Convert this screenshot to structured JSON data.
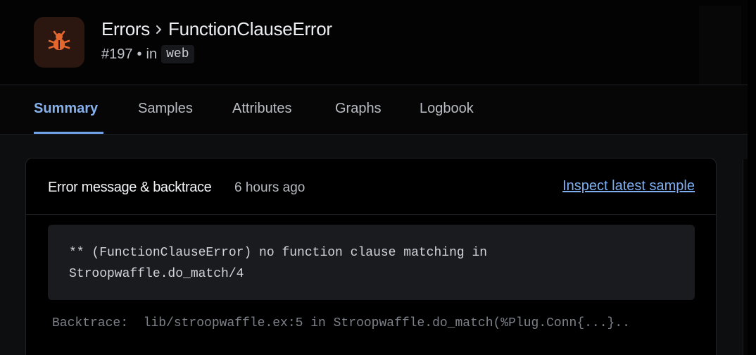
{
  "breadcrumb": {
    "parent": "Errors",
    "current": "FunctionClauseError"
  },
  "incident": {
    "number": "#197",
    "in_label": "in",
    "namespace": "web"
  },
  "tabs": [
    {
      "label": "Summary",
      "active": true
    },
    {
      "label": "Samples",
      "active": false
    },
    {
      "label": "Attributes",
      "active": false
    },
    {
      "label": "Graphs",
      "active": false
    },
    {
      "label": "Logbook",
      "active": false
    }
  ],
  "card": {
    "title": "Error message & backtrace",
    "time": "6 hours ago",
    "inspect_link": "Inspect latest sample",
    "message": "** (FunctionClauseError) no function clause matching in\nStroopwaffle.do_match/4",
    "backtrace": "Backtrace:  lib/stroopwaffle.ex:5 in Stroopwaffle.do_match(%Plug.Conn{...}.."
  },
  "colors": {
    "accent": "#86b1ec",
    "bug_icon": "#e2672f",
    "bug_tile": "#2b1710"
  },
  "icons": {
    "app": "bug-icon",
    "separator": "chevron-right-icon"
  }
}
